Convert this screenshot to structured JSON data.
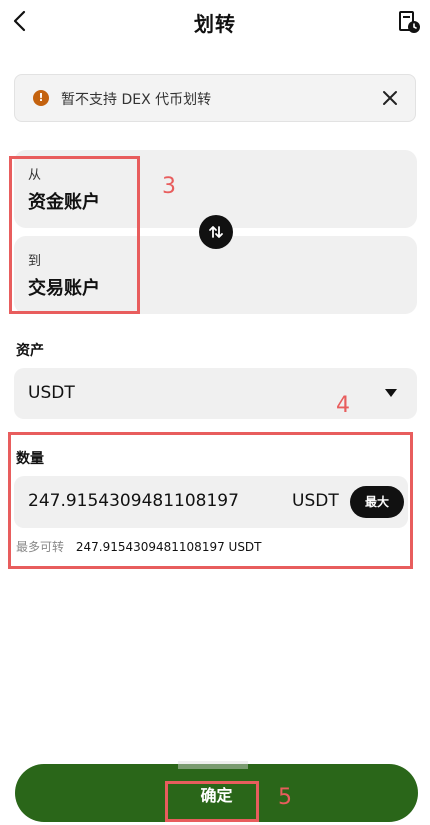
{
  "header": {
    "title": "划转",
    "back_icon": "chevron-left-icon",
    "records_icon": "document-clock-icon"
  },
  "notice": {
    "text": "暂不支持 DEX 代币划转",
    "icon_glyph": "!",
    "icon_color": "#c4620e"
  },
  "transfer": {
    "from_label": "从",
    "from_account": "资金账户",
    "to_label": "到",
    "to_account": "交易账户"
  },
  "asset": {
    "label": "资产",
    "selected": "USDT"
  },
  "quantity": {
    "label": "数量",
    "value": "247.9154309481108197",
    "unit": "USDT",
    "max_label": "最大",
    "available_label": "最多可转",
    "available_value": "247.9154309481108197 USDT"
  },
  "confirm": {
    "label": "确定",
    "color": "#2a6619"
  },
  "annotations": {
    "box3": "3",
    "box4": "4",
    "box5": "5",
    "color": "#e85d5d"
  }
}
